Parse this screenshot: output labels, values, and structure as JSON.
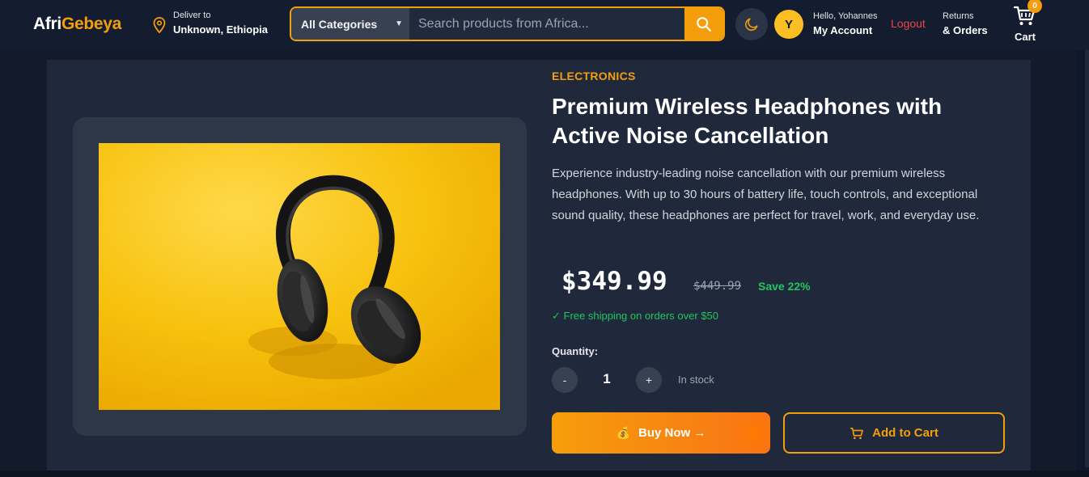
{
  "header": {
    "logo_part1": "Afri",
    "logo_part2": "Gebeya",
    "deliver_label": "Deliver to",
    "deliver_location": "Unknown, Ethiopia",
    "category_select": "All Categories",
    "search_placeholder": "Search products from Africa...",
    "avatar_initial": "Y",
    "greeting": "Hello, Yohannes",
    "account_label": "My Account",
    "logout_label": "Logout",
    "returns_line1": "Returns",
    "returns_line2": "& Orders",
    "cart_count": "0",
    "cart_label": "Cart"
  },
  "product": {
    "category": "ELECTRONICS",
    "title": "Premium Wireless Headphones with Active Noise Cancellation",
    "description": "Experience industry-leading noise cancellation with our premium wireless headphones. With up to 30 hours of battery life, touch controls, and exceptional sound quality, these headphones are perfect for travel, work, and everyday use.",
    "price": "$349.99",
    "original_price": "$449.99",
    "discount": "Save 22%",
    "shipping_note": "✓ Free shipping on orders over $50",
    "quantity_label": "Quantity:",
    "quantity_value": "1",
    "decrement_label": "-",
    "increment_label": "+",
    "stock_status": "In stock",
    "buy_now_label": "Buy Now →",
    "add_to_cart_label": "Add to Cart"
  },
  "colors": {
    "accent": "#f59e0b",
    "success": "#22c55e",
    "danger": "#ef4444",
    "background": "#121a2c",
    "card": "#1f293b"
  },
  "icons": {
    "location": "map-pin-icon",
    "search": "search-icon",
    "theme": "moon-icon",
    "cart": "cart-icon",
    "buy": "money-bag-icon",
    "add_to_cart": "cart-icon"
  }
}
